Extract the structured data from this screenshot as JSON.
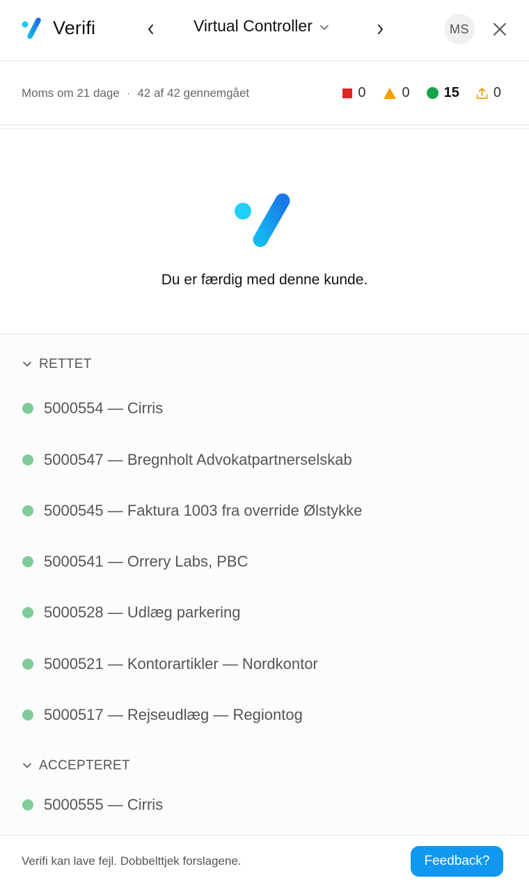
{
  "header": {
    "brand": "Verifi",
    "title": "Virtual Controller",
    "avatar_initials": "MS"
  },
  "status": {
    "deadline": "Moms om 21 dage",
    "separator": "·",
    "reviewed": "42 af 42 gennemgået",
    "counts": [
      {
        "icon": "red-square-icon",
        "color": "#e02424",
        "value": "0"
      },
      {
        "icon": "warning-triangle-icon",
        "color": "#f5a000",
        "value": "0"
      },
      {
        "icon": "green-circle-icon",
        "color": "#16a34a",
        "value": "15"
      },
      {
        "icon": "upload-icon",
        "color": "#e6a100",
        "value": "0"
      }
    ]
  },
  "done": {
    "message": "Du er færdig med denne kunde."
  },
  "sections": [
    {
      "label": "RETTET",
      "items": [
        "5000554 — Cirris",
        "5000547 — Bregnholt Advokatpartnerselskab",
        "5000545 — Faktura 1003 fra override Ølstykke",
        "5000541 — Orrery Labs, PBC",
        "5000528 — Udlæg parkering",
        "5000521 — Kontorartikler — Nordkontor",
        "5000517 — Rejseudlæg — Regiontog"
      ]
    },
    {
      "label": "ACCEPTERET",
      "items": [
        "5000555 — Cirris"
      ]
    }
  ],
  "footer": {
    "disclaimer": "Verifi kan lave fejl. Dobbelttjek forslagene.",
    "feedback_label": "Feedback?"
  },
  "colors": {
    "accent": "#1098f0",
    "status_dot": "#7fcc99"
  }
}
